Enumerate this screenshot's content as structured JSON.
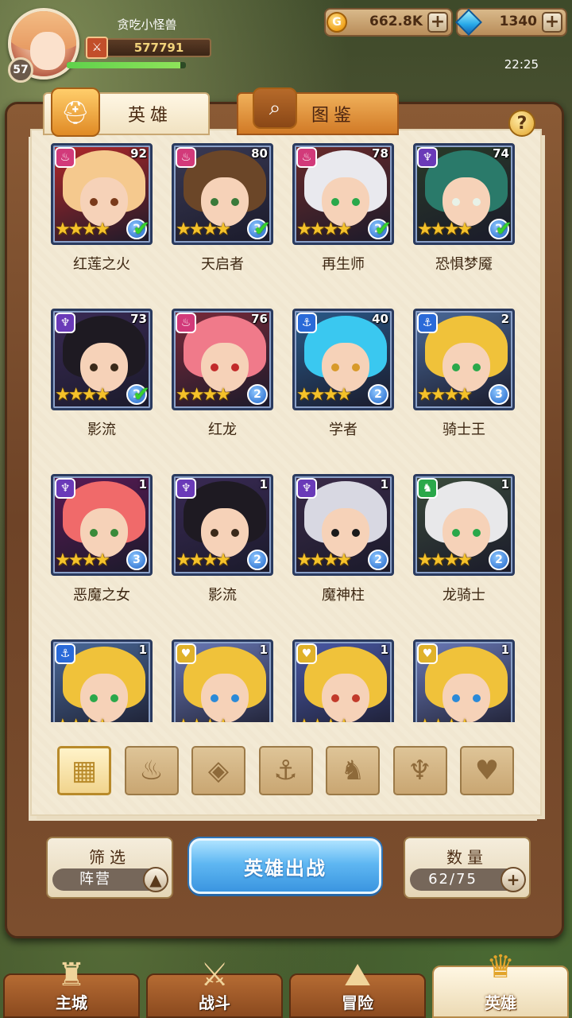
{
  "player": {
    "name": "贪吃小怪兽",
    "level": "57",
    "power": "577791",
    "exp_fraction": 0.95
  },
  "currency": {
    "gold": "662.8K",
    "gems": "1340"
  },
  "clock": "22:25",
  "tabs": {
    "heroes": "英雄",
    "codex": "图鉴"
  },
  "help": "?",
  "heroes": [
    {
      "name": "红莲之火",
      "level": "92",
      "faction_color": "#d23a7a",
      "faction_icon": "fire-icon",
      "rank": "2",
      "checked": true,
      "bg": "#b4282a",
      "hair": "#f5c98e",
      "eyes": "#7a3a1a"
    },
    {
      "name": "天启者",
      "level": "80",
      "faction_color": "#d23a7a",
      "faction_icon": "fire-icon",
      "rank": "3",
      "checked": true,
      "bg": "#3a3a55",
      "hair": "#6b4628",
      "eyes": "#3a7a3a"
    },
    {
      "name": "再生师",
      "level": "78",
      "faction_color": "#d23a7a",
      "faction_icon": "fire-icon",
      "rank": "2",
      "checked": true,
      "bg": "#6b2a2a",
      "hair": "#e9e9ee",
      "eyes": "#2aa84a"
    },
    {
      "name": "恐惧梦魇",
      "level": "74",
      "faction_color": "#6a3ab8",
      "faction_icon": "demon-icon",
      "rank": "2",
      "checked": true,
      "bg": "#2a3a28",
      "hair": "#2a7a6a",
      "eyes": "#e8f2e8"
    },
    {
      "name": "影流",
      "level": "73",
      "faction_color": "#6a3ab8",
      "faction_icon": "demon-icon",
      "rank": "2",
      "checked": true,
      "bg": "#3a2a55",
      "hair": "#1e1a22",
      "eyes": "#3a2a1a"
    },
    {
      "name": "红龙",
      "level": "76",
      "faction_color": "#d23a7a",
      "faction_icon": "fire-icon",
      "rank": "2",
      "checked": false,
      "bg": "#7a2a3a",
      "hair": "#f07a8a",
      "eyes": "#c22a2a"
    },
    {
      "name": "学者",
      "level": "40",
      "faction_color": "#2a6ad8",
      "faction_icon": "anchor-icon",
      "rank": "2",
      "checked": false,
      "bg": "#2a5a8a",
      "hair": "#3ac8f0",
      "eyes": "#d89a2a"
    },
    {
      "name": "骑士王",
      "level": "2",
      "faction_color": "#2a6ad8",
      "faction_icon": "anchor-icon",
      "rank": "3",
      "checked": false,
      "bg": "#4a6a9a",
      "hair": "#f0c23a",
      "eyes": "#2aa84a"
    },
    {
      "name": "恶魔之女",
      "level": "1",
      "faction_color": "#6a3ab8",
      "faction_icon": "demon-icon",
      "rank": "3",
      "checked": false,
      "bg": "#5a1a55",
      "hair": "#f06a6a",
      "eyes": "#3a8a3a"
    },
    {
      "name": "影流",
      "level": "1",
      "faction_color": "#6a3ab8",
      "faction_icon": "demon-icon",
      "rank": "2",
      "checked": false,
      "bg": "#3a2a55",
      "hair": "#1e1a22",
      "eyes": "#3a2a1a"
    },
    {
      "name": "魔神柱",
      "level": "1",
      "faction_color": "#6a3ab8",
      "faction_icon": "demon-icon",
      "rank": "2",
      "checked": false,
      "bg": "#3a2a48",
      "hair": "#d8d8e2",
      "eyes": "#1a1a1a"
    },
    {
      "name": "龙骑士",
      "level": "1",
      "faction_color": "#2aa84a",
      "faction_icon": "dragon-icon",
      "rank": "2",
      "checked": false,
      "bg": "#3a4a3a",
      "hair": "#e8e8ea",
      "eyes": "#2aa84a"
    },
    {
      "name": "",
      "level": "1",
      "faction_color": "#2a6ad8",
      "faction_icon": "anchor-icon",
      "rank": "",
      "checked": false,
      "bg": "#4a6a9a",
      "hair": "#f0c23a",
      "eyes": "#2aa84a"
    },
    {
      "name": "",
      "level": "1",
      "faction_color": "#e0b22a",
      "faction_icon": "holy-icon",
      "rank": "",
      "checked": false,
      "bg": "#6a7ab8",
      "hair": "#f0c23a",
      "eyes": "#2a8ad8"
    },
    {
      "name": "",
      "level": "1",
      "faction_color": "#e0b22a",
      "faction_icon": "holy-icon",
      "rank": "",
      "checked": false,
      "bg": "#4a5aa8",
      "hair": "#f0c23a",
      "eyes": "#c23a2a"
    },
    {
      "name": "",
      "level": "1",
      "faction_color": "#e0b22a",
      "faction_icon": "holy-icon",
      "rank": "",
      "checked": false,
      "bg": "#6a7ab8",
      "hair": "#f0c23a",
      "eyes": "#2a8ad8"
    }
  ],
  "stars_glyph": "★★★★",
  "filters": [
    {
      "name": "all-filter",
      "icon": "grid-icon",
      "glyph": "▦",
      "active": true
    },
    {
      "name": "fire-filter",
      "icon": "fire-icon",
      "glyph": "♨",
      "active": false
    },
    {
      "name": "earth-filter",
      "icon": "diamond-icon",
      "glyph": "◈",
      "active": false
    },
    {
      "name": "anchor-filter",
      "icon": "anchor-icon",
      "glyph": "⚓",
      "active": false
    },
    {
      "name": "dragon-filter",
      "icon": "dragon-icon",
      "glyph": "♞",
      "active": false
    },
    {
      "name": "demon-filter",
      "icon": "demon-icon",
      "glyph": "♆",
      "active": false
    },
    {
      "name": "holy-filter",
      "icon": "holy-icon",
      "glyph": "♥",
      "active": false
    }
  ],
  "bottom": {
    "filter_title": "筛选",
    "filter_value": "阵营",
    "deploy": "英雄出战",
    "count_title": "数量",
    "count_value": "62/75"
  },
  "nav": [
    {
      "label": "主城",
      "icon": "castle-icon",
      "glyph": "♜",
      "active": false
    },
    {
      "label": "战斗",
      "icon": "crossed-swords-icon",
      "glyph": "⚔",
      "active": false
    },
    {
      "label": "冒险",
      "icon": "map-icon",
      "glyph": "⛰",
      "active": false
    },
    {
      "label": "英雄",
      "icon": "helmet-icon",
      "glyph": "♛",
      "active": true
    }
  ]
}
